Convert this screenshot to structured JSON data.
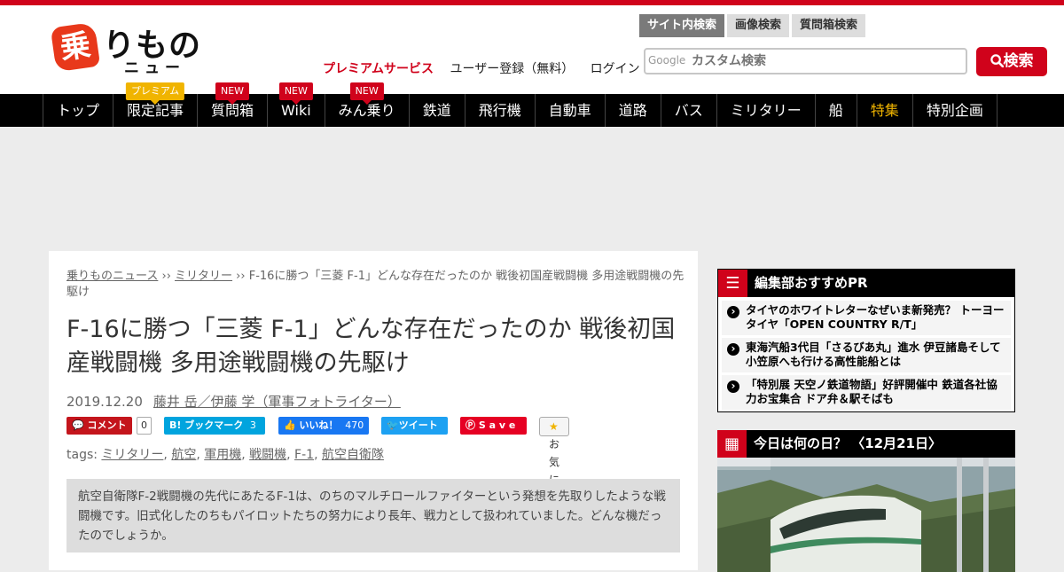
{
  "logo": {
    "badge": "乗",
    "title": "りもの",
    "sub": "ニュース"
  },
  "header_links": {
    "premium": "プレミアムサービス",
    "register": "ユーザー登録（無料）",
    "login": "ログイン"
  },
  "search": {
    "tabs": [
      "サイト内検索",
      "画像検索",
      "質問箱検索"
    ],
    "google": "Google",
    "value": "カスタム検索",
    "button": "検索"
  },
  "nav": [
    {
      "label": "トップ"
    },
    {
      "label": "限定記事",
      "tag": "プレミアム"
    },
    {
      "label": "質問箱",
      "tag": "NEW"
    },
    {
      "label": "Wiki",
      "tag": "NEW"
    },
    {
      "label": "みん乗り",
      "tag": "NEW"
    },
    {
      "label": "鉄道"
    },
    {
      "label": "飛行機"
    },
    {
      "label": "自動車"
    },
    {
      "label": "道路"
    },
    {
      "label": "バス"
    },
    {
      "label": "ミリタリー"
    },
    {
      "label": "船"
    },
    {
      "label": "特集"
    },
    {
      "label": "特別企画"
    }
  ],
  "colors": {
    "brand_red": "#d0021b",
    "feature_gold": "#f0b400",
    "nav_bg": "#000000"
  },
  "breadcrumb": {
    "home": "乗りものニュース",
    "sep": " ›› ",
    "category": "ミリタリー",
    "current": "F-16に勝つ「三菱 F-1」どんな存在だったのか 戦後初国産戦闘機 多用途戦闘機の先駆け"
  },
  "article": {
    "title": "F-16に勝つ「三菱 F-1」どんな存在だったのか 戦後初国産戦闘機 多用途戦闘機の先駆け",
    "date": "2019.12.20",
    "author": "藤井 岳／伊藤 学（軍事フォトライター）",
    "lead": "航空自衛隊F-2戦闘機の先代にあたるF-1は、のちのマルチロールファイターという発想を先取りしたような戦闘機です。旧式化したのちもパイロットたちの努力により長年、戦力として扱われていました。どんな機だったのでしょうか。"
  },
  "share": {
    "comment": "コメント",
    "comment_count": "0",
    "hatena": "B! ブックマーク",
    "hatena_count": "3",
    "like": "いいね！",
    "like_count": "470",
    "tweet": "ツイート",
    "save": "S a v e",
    "favorite": "お気に入り"
  },
  "tags": {
    "prefix": "tags:",
    "items": [
      "ミリタリー",
      "航空",
      "軍用機",
      "戦闘機",
      "F-1",
      "航空自衛隊"
    ]
  },
  "sidebar": {
    "pr_title": "編集部おすすめPR",
    "pr_items": [
      "タイヤのホワイトレターなぜいま新発売？ トーヨータイヤ「OPEN COUNTRY R/T」",
      "東海汽船3代目「さるびあ丸」進水 伊豆諸島そして小笠原へも行ける高性能船とは",
      "「特別展 天空ノ鉄道物語」好評開催中 鉄道各社協力お宝集合 ドア弁＆駅そばも"
    ],
    "today_title": "今日は何の日？ 〈12月21日〉"
  }
}
